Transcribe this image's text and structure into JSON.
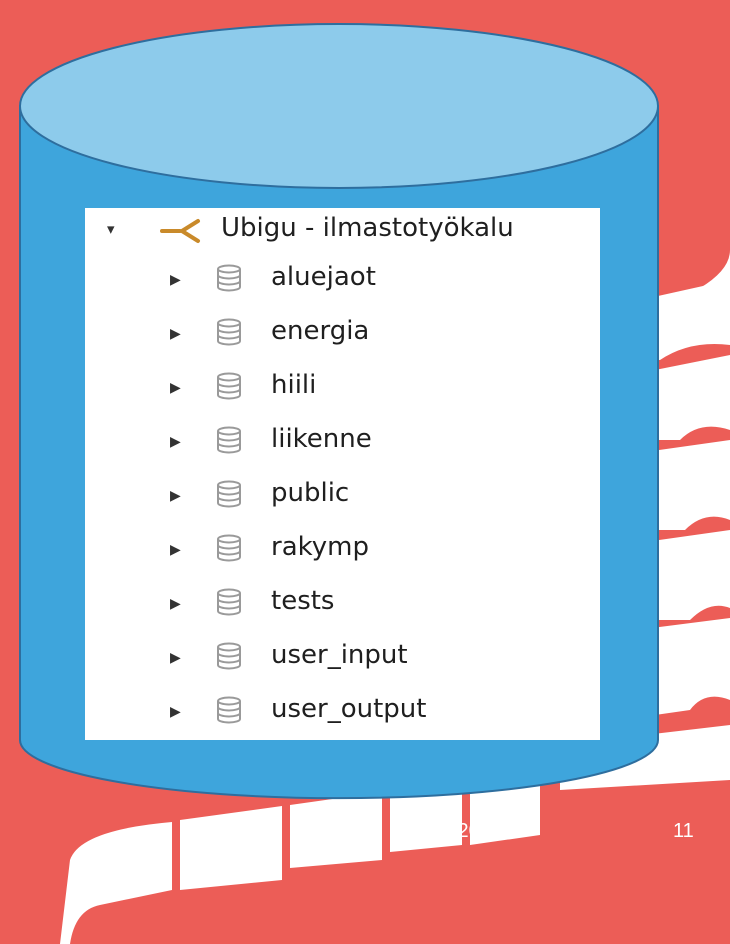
{
  "tree": {
    "root": {
      "label": "Ubigu - ilmastotyökalu",
      "icon": "server-connection-icon",
      "expanded": true
    },
    "schemas": [
      {
        "label": "aluejaot",
        "icon": "database-schema-icon"
      },
      {
        "label": "energia",
        "icon": "database-schema-icon"
      },
      {
        "label": "hiili",
        "icon": "database-schema-icon"
      },
      {
        "label": "liikenne",
        "icon": "database-schema-icon"
      },
      {
        "label": "public",
        "icon": "database-schema-icon"
      },
      {
        "label": "rakymp",
        "icon": "database-schema-icon"
      },
      {
        "label": "tests",
        "icon": "database-schema-icon"
      },
      {
        "label": "user_input",
        "icon": "database-schema-icon"
      },
      {
        "label": "user_output",
        "icon": "database-schema-icon"
      }
    ]
  },
  "footer": {
    "date": "30.8.2019",
    "page": "11"
  },
  "colors": {
    "background": "#EC5D57",
    "cylinder_body": "#3EA5DC",
    "cylinder_top": "#8DCBEB",
    "cylinder_outline": "#2E6E9E",
    "shape_white": "#FFFFFF",
    "server_icon": "#C98A2A",
    "schema_icon": "#9A9A9A"
  }
}
